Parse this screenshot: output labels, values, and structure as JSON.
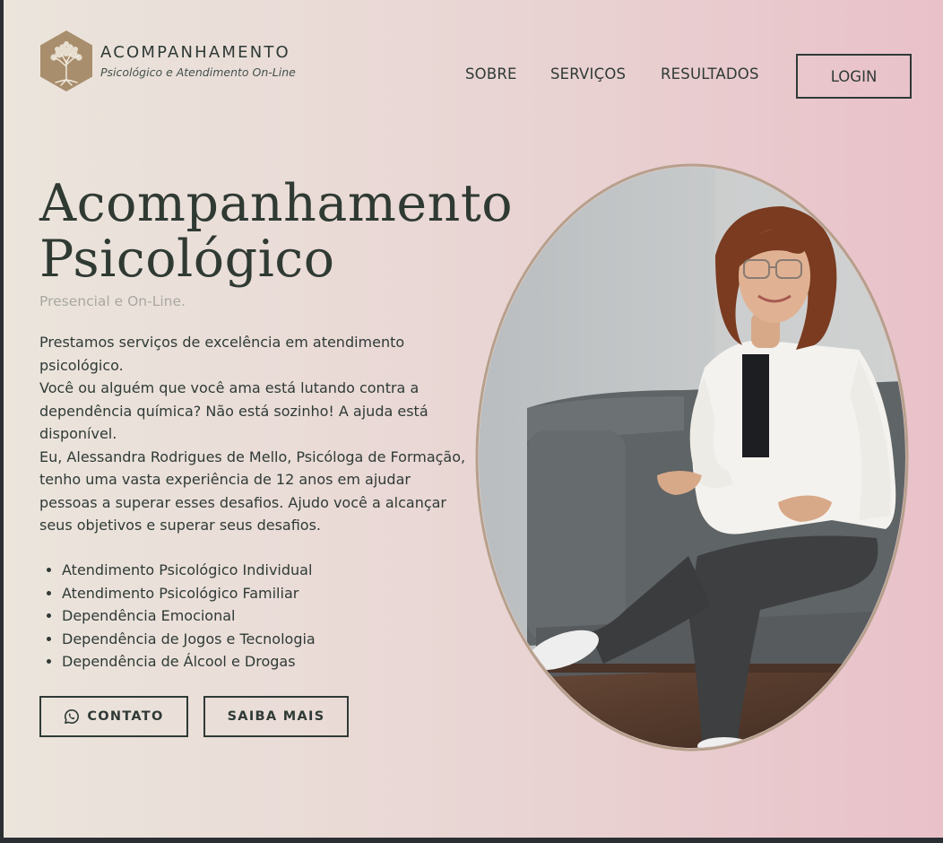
{
  "header": {
    "brand_title": "ACOMPANHAMENTO",
    "brand_subtitle": "Psicológico e Atendimento On-Line",
    "logo_icon": "tree-of-life-hexagon-icon",
    "nav": [
      "SOBRE",
      "SERVIÇOS",
      "RESULTADOS"
    ],
    "login_label": "LOGIN"
  },
  "hero": {
    "title_line1": "Acompanhamento",
    "title_line2": "Psicológico",
    "subtitle": "Presencial e On-Line.",
    "paragraphs": [
      "Prestamos serviços de excelência em atendimento psicológico.",
      "Você ou alguém que você ama está lutando contra a dependência química? Não está sozinho! A ajuda está disponível.",
      "Eu, Alessandra Rodrigues de Mello, Psicóloga de Formação, tenho uma vasta experiência de 12 anos em ajudar pessoas a superar esses desafios. Ajudo você a alcançar seus objetivos e superar seus desafios."
    ],
    "services": [
      "Atendimento Psicológico Individual",
      "Atendimento Psicológico Familiar",
      "Dependência Emocional",
      "Dependência de Jogos e Tecnologia",
      "Dependência de Álcool e Drogas"
    ],
    "contact_label": "CONTATO",
    "contact_icon": "whatsapp-icon",
    "more_label": "SAIBA MAIS"
  },
  "colors": {
    "text_dark": "#2f3a36",
    "logo_bg": "#a88e6d",
    "oval_border": "#b6a08c",
    "bg_left": "#ebe5dc",
    "bg_right": "#e9c1c9"
  }
}
